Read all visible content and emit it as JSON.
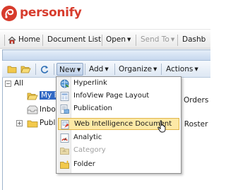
{
  "brand": {
    "name": "personify",
    "color": "#d73b2c"
  },
  "topbar": {
    "home": "Home",
    "document_list": "Document List",
    "open": "Open",
    "send_to": "Send To",
    "dashboards": "Dashb"
  },
  "toolbar": {
    "new": "New",
    "add": "Add",
    "organize": "Organize",
    "actions": "Actions"
  },
  "tree": {
    "all_label": "All",
    "items": [
      {
        "label": "My F",
        "icon": "open-folder-icon",
        "selected": true
      },
      {
        "label": "Inbox",
        "icon": "inbox-icon",
        "selected": false
      },
      {
        "label": "Publi",
        "icon": "folder-icon",
        "selected": false
      }
    ],
    "right_orders": "Orders",
    "right_roster": "e Roster"
  },
  "new_menu": {
    "items": [
      {
        "label": "Hyperlink",
        "icon": "hyperlink-icon",
        "enabled": true,
        "highlighted": false
      },
      {
        "label": "InfoView Page Layout",
        "icon": "page-layout-icon",
        "enabled": true,
        "highlighted": false
      },
      {
        "label": "Publication",
        "icon": "publication-icon",
        "enabled": true,
        "highlighted": false
      },
      {
        "label": "Web Intelligence Document",
        "icon": "webi-document-icon",
        "enabled": true,
        "highlighted": true
      },
      {
        "label": "Analytic",
        "icon": "analytic-icon",
        "enabled": true,
        "highlighted": false
      },
      {
        "label": "Category",
        "icon": "category-icon",
        "enabled": false,
        "highlighted": false
      },
      {
        "label": "Folder",
        "icon": "folder-icon",
        "enabled": true,
        "highlighted": false
      }
    ]
  }
}
